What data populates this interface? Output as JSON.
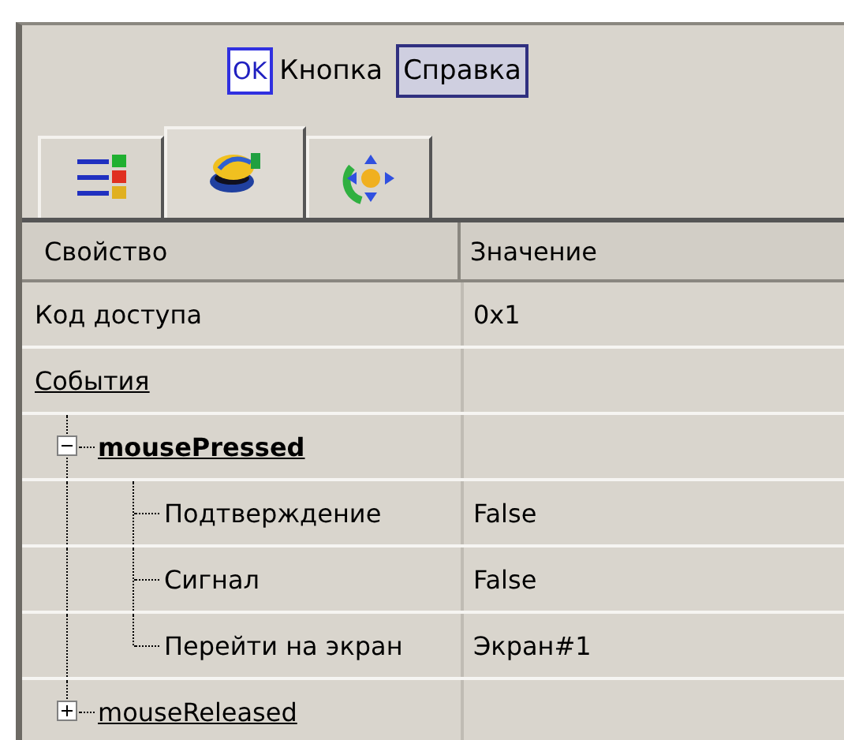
{
  "toolbar": {
    "button_icon_text": "OK",
    "button_label": "Кнопка",
    "help_button": "Справка"
  },
  "tabs": [
    {
      "kind": "list",
      "selected": false
    },
    {
      "kind": "events",
      "selected": true
    },
    {
      "kind": "move",
      "selected": false
    }
  ],
  "table": {
    "columns": [
      "Свойство",
      "Значение"
    ],
    "rows": [
      {
        "kind": "property",
        "name": "Код доступа",
        "value": "0x1"
      },
      {
        "kind": "category",
        "name": "События",
        "children": [
          {
            "kind": "event",
            "name": "mousePressed",
            "expanded": true,
            "selected": true,
            "children": [
              {
                "kind": "property",
                "name": "Подтверждение",
                "value": "False"
              },
              {
                "kind": "property",
                "name": "Сигнал",
                "value": "False"
              },
              {
                "kind": "property",
                "name": "Перейти на экран",
                "value": "Экран#1"
              }
            ]
          },
          {
            "kind": "event",
            "name": "mouseReleased",
            "expanded": false,
            "selected": false
          }
        ]
      }
    ]
  }
}
